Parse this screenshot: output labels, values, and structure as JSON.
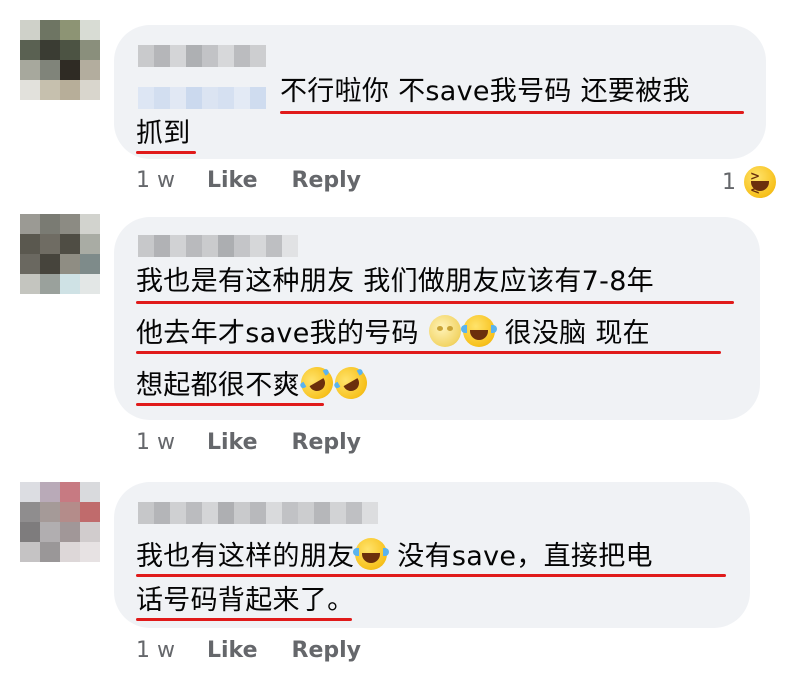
{
  "comments": [
    {
      "lines": [
        "不行啦你 不save我号码 还要被我",
        "抓到"
      ],
      "time": "1 w",
      "like_label": "Like",
      "reply_label": "Reply",
      "reaction_count": "1",
      "reaction_icon": "squinting-laugh-icon"
    },
    {
      "lines": [
        "我也是有这种朋友 我们做朋友应该有7-8年",
        "他去年才save我的号码 ",
        " 很没脑 现在",
        "想起都很不爽"
      ],
      "emojis": [
        "moon-face-icon",
        "joy-icon",
        "rofl-icon",
        "rofl-icon"
      ],
      "time": "1 w",
      "like_label": "Like",
      "reply_label": "Reply"
    },
    {
      "lines": [
        "我也有这样的朋友",
        " 没有save，直接把电",
        "话号码背起来了。"
      ],
      "emojis": [
        "joy-icon"
      ],
      "time": "1 w",
      "like_label": "Like",
      "reply_label": "Reply"
    }
  ],
  "colors": {
    "bubble": "#f0f2f5",
    "underline": "#e01a1a",
    "meta_text": "#65676b"
  }
}
